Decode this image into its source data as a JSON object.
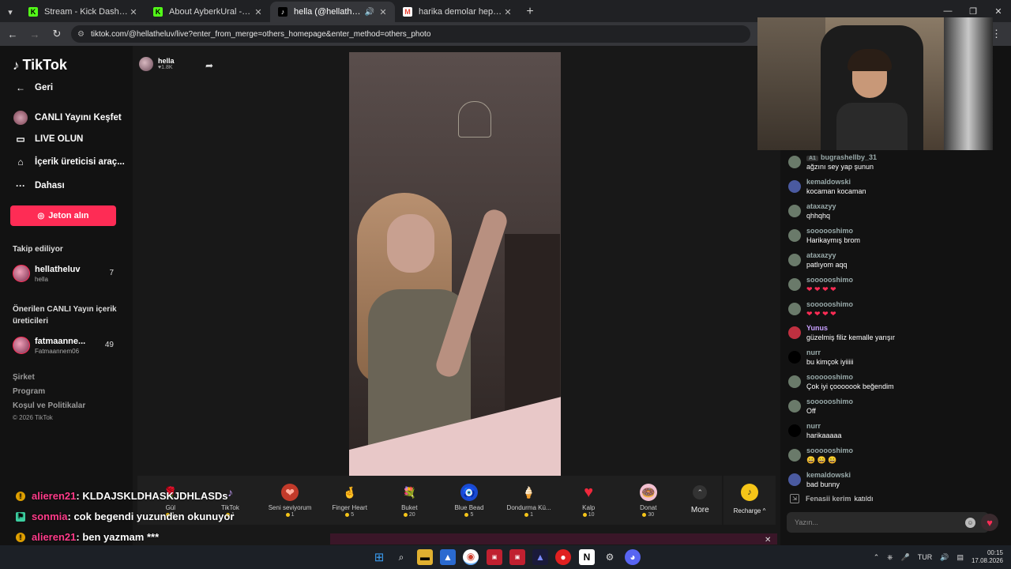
{
  "browser": {
    "tabs": [
      {
        "title": "Stream - Kick Dashboard",
        "favicon": "K",
        "color": "#53fc18",
        "active": false
      },
      {
        "title": "About AyberkUral - Watch Live",
        "favicon": "K",
        "color": "#53fc18",
        "active": false
      },
      {
        "title": "hella (@hellatheluv) CANLI",
        "favicon": "♪",
        "color": "#ffffff",
        "active": true
      },
      {
        "title": "harika demolar hepsini dinle kü",
        "favicon": "M",
        "color": "#ea4335",
        "active": false
      }
    ],
    "url": "tiktok.com/@hellatheluv/live?enter_from_merge=others_homepage&enter_method=others_photo"
  },
  "sidebar": {
    "logo": "TikTok",
    "back": "Geri",
    "nav": [
      {
        "label": "CANLI Yayını Keşfet",
        "icon": "live-discover-icon"
      },
      {
        "label": "LIVE OLUN",
        "icon": "camera-icon"
      },
      {
        "label": "İçerik üreticisi araç...",
        "icon": "home-tools-icon"
      },
      {
        "label": "Dahası",
        "icon": "more-dots-icon"
      }
    ],
    "coin_button": "Jeton alın",
    "following_title": "Takip ediliyor",
    "following": {
      "name": "hellatheluv",
      "sub": "hella",
      "count": "7"
    },
    "suggested_title": "Önerilen CANLI Yayın içerik üreticileri",
    "suggested": {
      "name": "fatmaanne...",
      "sub": "Fatmaannem06",
      "count": "49"
    },
    "footer": [
      "Şirket",
      "Program",
      "Koşul ve Politikalar",
      "© 2026 TikTok"
    ]
  },
  "host": {
    "name": "hella",
    "likes": "♥1.8K"
  },
  "gifts": [
    {
      "name": "Gül",
      "price": "1",
      "icon": "🌹"
    },
    {
      "name": "TikTok",
      "price": "1",
      "icon": "♪"
    },
    {
      "name": "Seni seviyorum",
      "price": "1",
      "icon": "❤"
    },
    {
      "name": "Finger Heart",
      "price": "5",
      "icon": "🤞"
    },
    {
      "name": "Buket",
      "price": "20",
      "icon": "💐"
    },
    {
      "name": "Blue Bead",
      "price": "5",
      "icon": "🧿"
    },
    {
      "name": "Dondurma Kü...",
      "price": "1",
      "icon": "🍦"
    },
    {
      "name": "Kalp",
      "price": "10",
      "icon": "♥"
    },
    {
      "name": "Donat",
      "price": "30",
      "icon": "🍩"
    }
  ],
  "more_label": "More",
  "recharge_label": "Recharge ^",
  "chat": [
    {
      "user": "bugrashellby_31",
      "text": "ağzını sey yap şunun",
      "badge": "A1"
    },
    {
      "user": "kemaldowski",
      "text": "kocaman kocaman"
    },
    {
      "user": "ataxazyy",
      "text": "qhhqhq"
    },
    {
      "user": "soooooshimo",
      "text": "Harikaymış brom"
    },
    {
      "user": "ataxazyy",
      "text": "patlıyom aqq"
    },
    {
      "user": "soooooshimo",
      "text": "❤ ❤ ❤ ❤"
    },
    {
      "user": "soooooshimo",
      "text": "❤ ❤ ❤ ❤"
    },
    {
      "user": "Yunus",
      "text": "güzelmiş filiz kemalle yarışır"
    },
    {
      "user": "nurr",
      "text": "bu kimçok iyiiiii"
    },
    {
      "user": "soooooshimo",
      "text": "Çok iyi çooooook beğendim"
    },
    {
      "user": "soooooshimo",
      "text": "Off"
    },
    {
      "user": "nurr",
      "text": "harikaaaaa"
    },
    {
      "user": "soooooshimo",
      "text": "😄 😄 😄"
    },
    {
      "user": "kemaldowski",
      "text": "bad bunny"
    }
  ],
  "joined": {
    "name": "Fenasii kerim",
    "word": "katıldı"
  },
  "input_placeholder": "Yazın...",
  "overlay_chat": [
    {
      "user": "alieren21",
      "text": ": KLDAJSKLDHASKJDHLASDs",
      "color": "#ff3c8a"
    },
    {
      "user": "sonmia",
      "text": ": cok begendi yuzunden okunuyor",
      "color": "#ff3c8a"
    },
    {
      "user": "alieren21",
      "text": ": ben yazmam ***",
      "color": "#ff3c8a"
    }
  ],
  "taskbar": {
    "lang": "TUR",
    "time": "00:15",
    "date": "17.08.2026"
  }
}
